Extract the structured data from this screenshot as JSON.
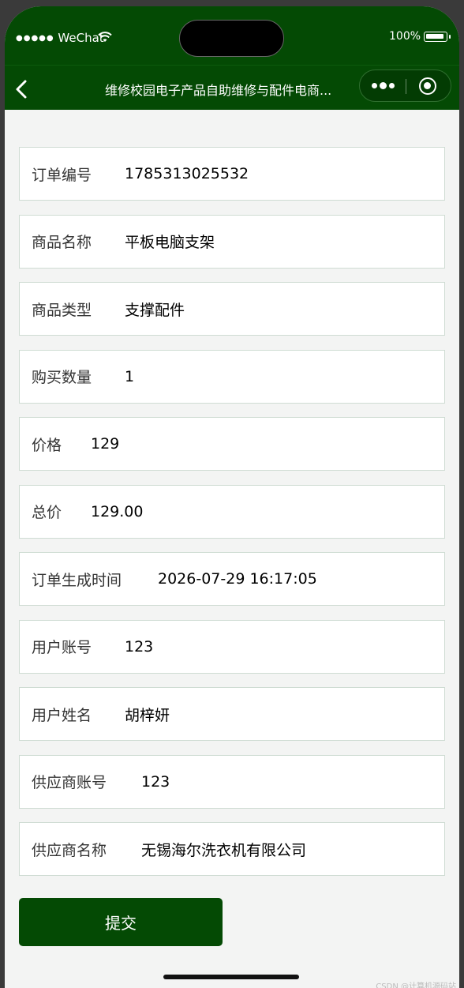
{
  "status_bar": {
    "carrier": "WeChat",
    "battery": "100%"
  },
  "nav": {
    "title": "维修校园电子产品自助维修与配件电商..."
  },
  "fields": [
    {
      "label": "订单编号",
      "value": "1785313025532"
    },
    {
      "label": "商品名称",
      "value": "平板电脑支架"
    },
    {
      "label": "商品类型",
      "value": "支撑配件"
    },
    {
      "label": "购买数量",
      "value": "1"
    },
    {
      "label": "价格",
      "value": "129"
    },
    {
      "label": "总价",
      "value": "129.00"
    },
    {
      "label": "订单生成时间",
      "value": "2026-07-29 16:17:05"
    },
    {
      "label": "用户账号",
      "value": "123"
    },
    {
      "label": "用户姓名",
      "value": "胡梓妍"
    },
    {
      "label": "供应商账号",
      "value": "123"
    },
    {
      "label": "供应商名称",
      "value": "无锡海尔洗衣机有限公司"
    }
  ],
  "submit_label": "提交",
  "watermark": "CSDN @计算机源码站",
  "colors": {
    "primary": "#044a04",
    "background": "#f3f4f3",
    "border": "#cfdcd3"
  }
}
